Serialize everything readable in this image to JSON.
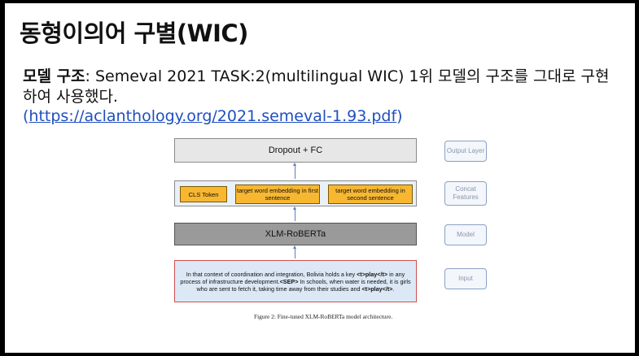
{
  "slide": {
    "title": "동형이의어 구별(WIC)",
    "body_bold": "모델 구조",
    "body_rest": ": Semeval 2021 TASK:2(multilingual WIC) 1위 모델의 구조를 그대로 구현하여 사용했다.",
    "link_open": "(",
    "link_text": "https://aclanthology.org/2021.semeval-1.93.pdf",
    "link_close": ")"
  },
  "figure": {
    "output_box": "Dropout + FC",
    "tokens": [
      "CLS Token",
      "target word embedding in first sentence",
      "target word embedding in second sentence"
    ],
    "model_box": "XLM-RoBERTa",
    "input_parts": {
      "p1": "In that context of coordination and integration, Bolivia holds a key ",
      "t1": "<t>play</t>",
      "p2": " in any process of infrastructure development.",
      "sep": "<SEP>",
      "p3": " In schools, when water is needed, it is girls who are sent to fetch it, taking time away from their studies and ",
      "t2": "<t>play</t>",
      "p4": "."
    },
    "side_labels": [
      "Output Layer",
      "Concat Features",
      "Model",
      "Input"
    ],
    "caption": "Figure 2: Fine-tuned XLM-RoBERTa model architecture."
  }
}
